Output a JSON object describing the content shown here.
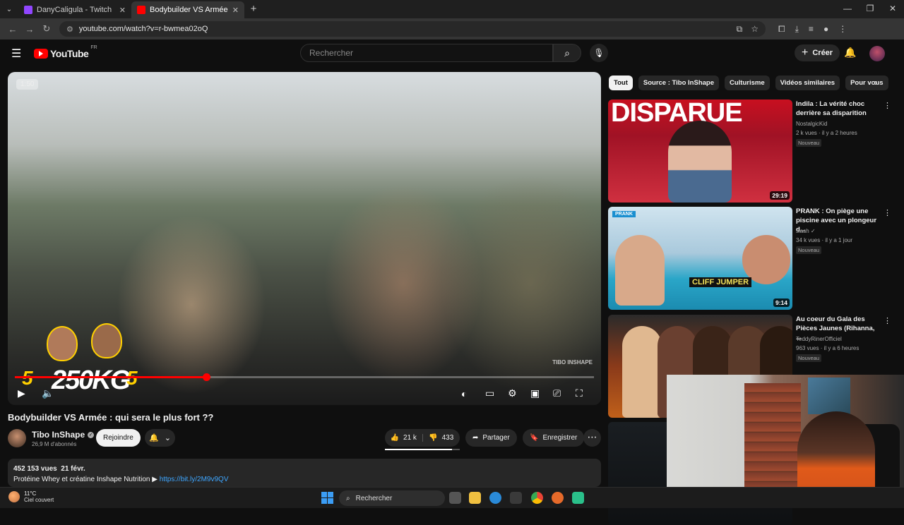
{
  "browser": {
    "tabs": [
      {
        "title": "DanyCaligula - Twitch",
        "active": false,
        "favicon_color": "#9146ff"
      },
      {
        "title": "Bodybuilder VS Armée : qui sera",
        "active": true,
        "favicon_color": "#ff0000"
      }
    ],
    "url": "youtube.com/watch?v=r-bwmea02oQ"
  },
  "youtube": {
    "logo_text": "YouTube",
    "logo_region": "FR",
    "search_placeholder": "Rechercher",
    "create_label": "Créer"
  },
  "player": {
    "chapter_badge": "1:50",
    "overlay_left_number": "5",
    "overlay_weight": "250KG",
    "overlay_right_number": "5",
    "watermark": "TIBO INSHAPE",
    "progress_fraction": 0.33
  },
  "video": {
    "title": "Bodybuilder VS Armée : qui sera le plus fort ??",
    "channel_name": "Tibo InShape",
    "channel_subs": "26,9 M d'abonnés",
    "join_label": "Rejoindre",
    "likes": "21 k",
    "dislikes": "433",
    "share_label": "Partager",
    "save_label": "Enregistrer",
    "views": "452 153 vues",
    "date": "21 févr.",
    "desc_line": "Protéine Whey et créatine Inshape Nutrition ▶",
    "desc_link": "https://bit.ly/2M9v9QV"
  },
  "chips": [
    "Tout",
    "Source : Tibo InShape",
    "Culturisme",
    "Vidéos similaires",
    "Pour vous"
  ],
  "recommendations": [
    {
      "title": "Indila : La vérité choc derrière sa disparition",
      "channel": "NostalgicKid",
      "meta": "2 k vues · il y a 2 heures",
      "badge": "Nouveau",
      "duration": "29:19",
      "thumb_text": "DISPARUE"
    },
    {
      "title": "PRANK : On piège une piscine avec un plongeur d...",
      "channel": "slash",
      "meta": "34 k vues · il y a 1 jour",
      "badge": "Nouveau",
      "duration": "9:14",
      "thumb_tag": "PRANK",
      "thumb_banner": "CLIFF JUMPER"
    },
    {
      "title": "Au coeur du Gala des Pièces Jaunes (Rihanna, ...",
      "channel": "TeddyRinerOfficiel",
      "meta": "963 vues · il y a 6 heures",
      "badge": "Nouveau",
      "duration": "",
      "thumb_text": ""
    }
  ],
  "taskbar": {
    "temperature": "11°C",
    "weather": "Ciel couvert",
    "search_label": "Rechercher"
  }
}
